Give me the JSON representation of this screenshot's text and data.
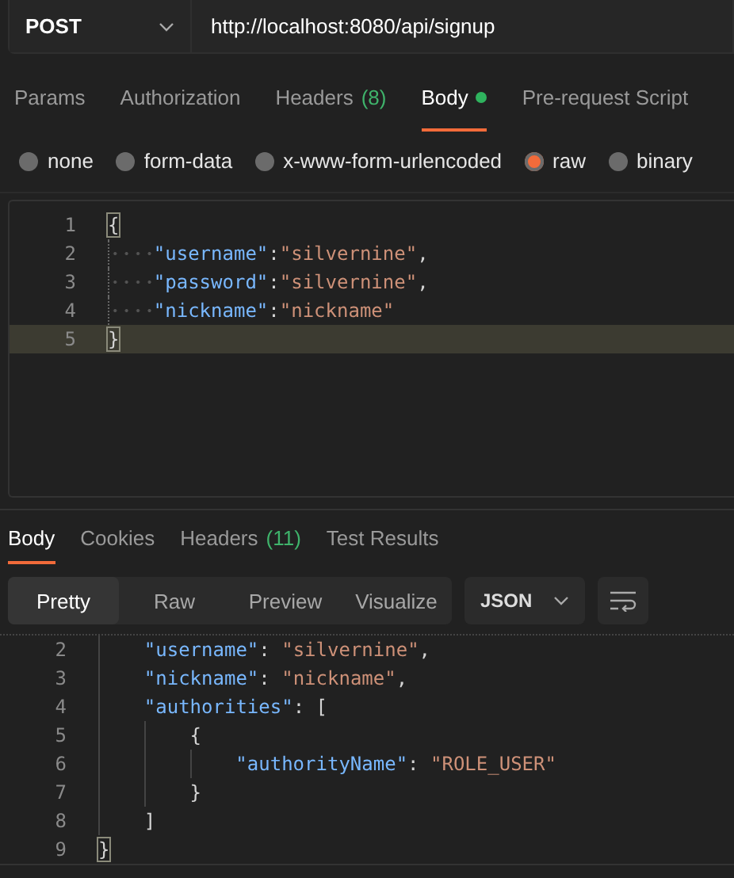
{
  "request": {
    "method": "POST",
    "url": "http://localhost:8080/api/signup"
  },
  "request_tabs": [
    {
      "label": "Params",
      "selected": false,
      "dot": false
    },
    {
      "label": "Authorization",
      "selected": false,
      "dot": false
    },
    {
      "label": "Headers",
      "count": "(8)",
      "selected": false,
      "dot": false
    },
    {
      "label": "Body",
      "selected": true,
      "dot": true
    },
    {
      "label": "Pre-request Script",
      "selected": false,
      "dot": false
    }
  ],
  "body_types": [
    {
      "label": "none",
      "selected": false
    },
    {
      "label": "form-data",
      "selected": false
    },
    {
      "label": "x-www-form-urlencoded",
      "selected": false
    },
    {
      "label": "raw",
      "selected": true
    },
    {
      "label": "binary",
      "selected": false
    }
  ],
  "request_editor": {
    "show_whitespace": true,
    "lines": [
      {
        "number": "1",
        "current": false,
        "tokens": [
          {
            "kind": "match",
            "text": "{"
          }
        ],
        "children": [
          {
            "number": "2",
            "current": false,
            "tokens": [
              {
                "kind": "key",
                "text": "\"username\""
              },
              {
                "kind": "punct",
                "text": ":"
              },
              {
                "kind": "string",
                "text": "\"silvernine\""
              },
              {
                "kind": "punct",
                "text": ","
              }
            ]
          },
          {
            "number": "3",
            "current": false,
            "tokens": [
              {
                "kind": "key",
                "text": "\"password\""
              },
              {
                "kind": "punct",
                "text": ":"
              },
              {
                "kind": "string",
                "text": "\"silvernine\""
              },
              {
                "kind": "punct",
                "text": ","
              }
            ]
          },
          {
            "number": "4",
            "current": false,
            "tokens": [
              {
                "kind": "key",
                "text": "\"nickname\""
              },
              {
                "kind": "punct",
                "text": ":"
              },
              {
                "kind": "string",
                "text": "\"nickname\""
              }
            ]
          }
        ]
      },
      {
        "number": "5",
        "current": true,
        "tokens": [
          {
            "kind": "match",
            "text": "}"
          }
        ]
      }
    ]
  },
  "response_tabs": [
    {
      "label": "Body",
      "selected": true
    },
    {
      "label": "Cookies",
      "selected": false
    },
    {
      "label": "Headers",
      "count": "(11)",
      "selected": false
    },
    {
      "label": "Test Results",
      "selected": false
    }
  ],
  "view_modes": [
    {
      "label": "Pretty",
      "selected": true
    },
    {
      "label": "Raw",
      "selected": false
    },
    {
      "label": "Preview",
      "selected": false
    },
    {
      "label": "Visualize",
      "selected": false
    }
  ],
  "format": "JSON",
  "response_editor": {
    "show_whitespace": false,
    "lines": [
      {
        "children": [
          {
            "number": "2",
            "current": false,
            "tokens": [
              {
                "kind": "key",
                "text": "\"username\""
              },
              {
                "kind": "punct",
                "text": ": "
              },
              {
                "kind": "string",
                "text": "\"silvernine\""
              },
              {
                "kind": "punct",
                "text": ","
              }
            ]
          },
          {
            "number": "3",
            "current": false,
            "tokens": [
              {
                "kind": "key",
                "text": "\"nickname\""
              },
              {
                "kind": "punct",
                "text": ": "
              },
              {
                "kind": "string",
                "text": "\"nickname\""
              },
              {
                "kind": "punct",
                "text": ","
              }
            ]
          },
          {
            "number": "4",
            "current": false,
            "tokens": [
              {
                "kind": "key",
                "text": "\"authorities\""
              },
              {
                "kind": "punct",
                "text": ": ["
              }
            ],
            "children": [
              {
                "number": "5",
                "current": false,
                "tokens": [
                  {
                    "kind": "punct",
                    "text": "{"
                  }
                ],
                "children": [
                  {
                    "number": "6",
                    "current": false,
                    "tokens": [
                      {
                        "kind": "key",
                        "text": "\"authorityName\""
                      },
                      {
                        "kind": "punct",
                        "text": ": "
                      },
                      {
                        "kind": "string",
                        "text": "\"ROLE_USER\""
                      }
                    ]
                  }
                ]
              },
              {
                "number": "7",
                "current": false,
                "tokens": [
                  {
                    "kind": "punct",
                    "text": "}"
                  }
                ]
              }
            ]
          },
          {
            "number": "8",
            "current": false,
            "tokens": [
              {
                "kind": "punct",
                "text": "]"
              }
            ]
          }
        ]
      },
      {
        "number": "9",
        "current": false,
        "tokens": [
          {
            "kind": "match",
            "text": "}"
          }
        ]
      }
    ]
  }
}
